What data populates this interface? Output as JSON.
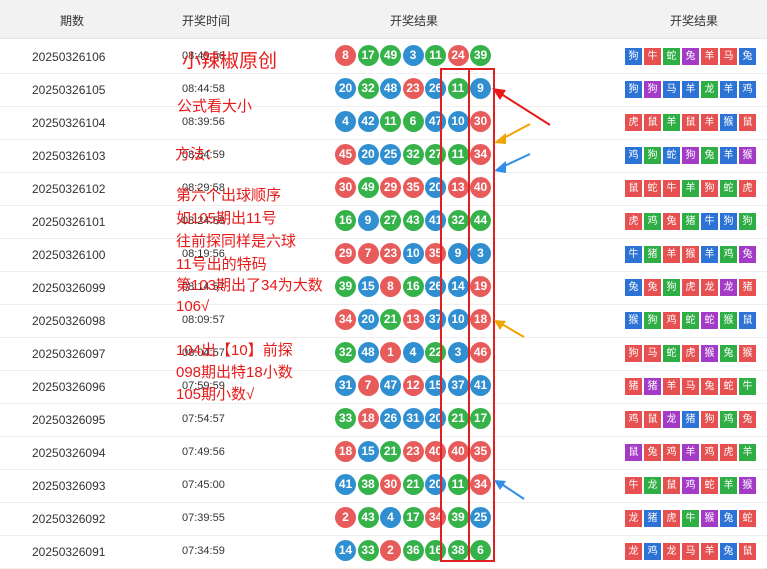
{
  "header": {
    "issue": "期数",
    "time": "开奖时间",
    "balls": "开奖结果",
    "zodiac": "开奖结果"
  },
  "colors": {
    "red": "#e85b5b",
    "blue": "#2f8fd0",
    "green": "#35b34a",
    "purple": "#a33bc6",
    "annot": "#e81919"
  },
  "rows": [
    {
      "issue": "20250326106",
      "time": "08:49:56",
      "balls": [
        [
          "8",
          "red"
        ],
        [
          "17",
          "green"
        ],
        [
          "49",
          "green"
        ],
        [
          "3",
          "blue"
        ],
        [
          "11",
          "green"
        ],
        [
          "24",
          "red"
        ],
        [
          "39",
          "green"
        ]
      ],
      "zodiac": [
        [
          "狗",
          "blue"
        ],
        [
          "牛",
          "red"
        ],
        [
          "蛇",
          "green"
        ],
        [
          "兔",
          "purple"
        ],
        [
          "羊",
          "red"
        ],
        [
          "马",
          "red"
        ],
        [
          "兔",
          "blue"
        ]
      ]
    },
    {
      "issue": "20250326105",
      "time": "08:44:58",
      "balls": [
        [
          "20",
          "blue"
        ],
        [
          "32",
          "green"
        ],
        [
          "48",
          "blue"
        ],
        [
          "23",
          "red"
        ],
        [
          "26",
          "blue"
        ],
        [
          "11",
          "green"
        ],
        [
          "9",
          "blue"
        ]
      ],
      "zodiac": [
        [
          "狗",
          "blue"
        ],
        [
          "狗",
          "purple"
        ],
        [
          "马",
          "blue"
        ],
        [
          "羊",
          "blue"
        ],
        [
          "龙",
          "green"
        ],
        [
          "羊",
          "blue"
        ],
        [
          "鸡",
          "blue"
        ]
      ]
    },
    {
      "issue": "20250326104",
      "time": "08:39:56",
      "balls": [
        [
          "4",
          "blue"
        ],
        [
          "42",
          "blue"
        ],
        [
          "11",
          "green"
        ],
        [
          "6",
          "green"
        ],
        [
          "47",
          "blue"
        ],
        [
          "10",
          "blue"
        ],
        [
          "30",
          "red"
        ]
      ],
      "zodiac": [
        [
          "虎",
          "red"
        ],
        [
          "鼠",
          "red"
        ],
        [
          "羊",
          "green"
        ],
        [
          "鼠",
          "red"
        ],
        [
          "羊",
          "red"
        ],
        [
          "猴",
          "blue"
        ],
        [
          "鼠",
          "red"
        ]
      ]
    },
    {
      "issue": "20250326103",
      "time": "08:34:59",
      "balls": [
        [
          "45",
          "red"
        ],
        [
          "20",
          "blue"
        ],
        [
          "25",
          "blue"
        ],
        [
          "32",
          "green"
        ],
        [
          "27",
          "green"
        ],
        [
          "11",
          "green"
        ],
        [
          "34",
          "red"
        ]
      ],
      "zodiac": [
        [
          "鸡",
          "blue"
        ],
        [
          "狗",
          "green"
        ],
        [
          "蛇",
          "blue"
        ],
        [
          "狗",
          "purple"
        ],
        [
          "兔",
          "green"
        ],
        [
          "羊",
          "blue"
        ],
        [
          "猴",
          "purple"
        ]
      ]
    },
    {
      "issue": "20250326102",
      "time": "08:29:58",
      "balls": [
        [
          "30",
          "red"
        ],
        [
          "49",
          "green"
        ],
        [
          "29",
          "red"
        ],
        [
          "35",
          "red"
        ],
        [
          "20",
          "blue"
        ],
        [
          "13",
          "red"
        ],
        [
          "40",
          "red"
        ]
      ],
      "zodiac": [
        [
          "鼠",
          "red"
        ],
        [
          "蛇",
          "red"
        ],
        [
          "牛",
          "red"
        ],
        [
          "羊",
          "green"
        ],
        [
          "狗",
          "red"
        ],
        [
          "蛇",
          "green"
        ],
        [
          "虎",
          "red"
        ]
      ]
    },
    {
      "issue": "20250326101",
      "time": "08:24:58",
      "balls": [
        [
          "16",
          "green"
        ],
        [
          "9",
          "blue"
        ],
        [
          "27",
          "green"
        ],
        [
          "43",
          "green"
        ],
        [
          "41",
          "blue"
        ],
        [
          "32",
          "green"
        ],
        [
          "44",
          "green"
        ]
      ],
      "zodiac": [
        [
          "虎",
          "red"
        ],
        [
          "鸡",
          "green"
        ],
        [
          "兔",
          "red"
        ],
        [
          "猪",
          "green"
        ],
        [
          "牛",
          "blue"
        ],
        [
          "狗",
          "blue"
        ],
        [
          "狗",
          "green"
        ]
      ]
    },
    {
      "issue": "20250326100",
      "time": "08:19:56",
      "balls": [
        [
          "29",
          "red"
        ],
        [
          "7",
          "red"
        ],
        [
          "23",
          "red"
        ],
        [
          "10",
          "blue"
        ],
        [
          "35",
          "red"
        ],
        [
          "9",
          "blue"
        ],
        [
          "3",
          "blue"
        ]
      ],
      "zodiac": [
        [
          "牛",
          "blue"
        ],
        [
          "猪",
          "green"
        ],
        [
          "羊",
          "red"
        ],
        [
          "猴",
          "red"
        ],
        [
          "羊",
          "blue"
        ],
        [
          "鸡",
          "green"
        ],
        [
          "兔",
          "purple"
        ]
      ]
    },
    {
      "issue": "20250326099",
      "time": "08:14:57",
      "balls": [
        [
          "39",
          "green"
        ],
        [
          "15",
          "blue"
        ],
        [
          "8",
          "red"
        ],
        [
          "16",
          "green"
        ],
        [
          "26",
          "blue"
        ],
        [
          "14",
          "blue"
        ],
        [
          "19",
          "red"
        ]
      ],
      "zodiac": [
        [
          "兔",
          "blue"
        ],
        [
          "兔",
          "red"
        ],
        [
          "狗",
          "green"
        ],
        [
          "虎",
          "red"
        ],
        [
          "龙",
          "red"
        ],
        [
          "龙",
          "purple"
        ],
        [
          "猪",
          "red"
        ]
      ]
    },
    {
      "issue": "20250326098",
      "time": "08:09:57",
      "balls": [
        [
          "34",
          "red"
        ],
        [
          "20",
          "blue"
        ],
        [
          "21",
          "green"
        ],
        [
          "13",
          "red"
        ],
        [
          "37",
          "blue"
        ],
        [
          "10",
          "blue"
        ],
        [
          "18",
          "red"
        ]
      ],
      "zodiac": [
        [
          "猴",
          "blue"
        ],
        [
          "狗",
          "green"
        ],
        [
          "鸡",
          "red"
        ],
        [
          "蛇",
          "green"
        ],
        [
          "蛇",
          "purple"
        ],
        [
          "猴",
          "green"
        ],
        [
          "鼠",
          "blue"
        ]
      ]
    },
    {
      "issue": "20250326097",
      "time": "08:04:57",
      "balls": [
        [
          "32",
          "green"
        ],
        [
          "48",
          "blue"
        ],
        [
          "1",
          "red"
        ],
        [
          "4",
          "blue"
        ],
        [
          "22",
          "green"
        ],
        [
          "3",
          "blue"
        ],
        [
          "46",
          "red"
        ]
      ],
      "zodiac": [
        [
          "狗",
          "red"
        ],
        [
          "马",
          "red"
        ],
        [
          "蛇",
          "green"
        ],
        [
          "虎",
          "red"
        ],
        [
          "猴",
          "purple"
        ],
        [
          "兔",
          "green"
        ],
        [
          "猴",
          "red"
        ]
      ]
    },
    {
      "issue": "20250326096",
      "time": "07:59:59",
      "balls": [
        [
          "31",
          "blue"
        ],
        [
          "7",
          "red"
        ],
        [
          "47",
          "blue"
        ],
        [
          "12",
          "red"
        ],
        [
          "15",
          "blue"
        ],
        [
          "37",
          "blue"
        ],
        [
          "41",
          "blue"
        ]
      ],
      "zodiac": [
        [
          "猪",
          "red"
        ],
        [
          "猪",
          "purple"
        ],
        [
          "羊",
          "red"
        ],
        [
          "马",
          "red"
        ],
        [
          "兔",
          "red"
        ],
        [
          "蛇",
          "red"
        ],
        [
          "牛",
          "green"
        ]
      ]
    },
    {
      "issue": "20250326095",
      "time": "07:54:57",
      "balls": [
        [
          "33",
          "green"
        ],
        [
          "18",
          "red"
        ],
        [
          "26",
          "blue"
        ],
        [
          "31",
          "blue"
        ],
        [
          "20",
          "blue"
        ],
        [
          "21",
          "green"
        ],
        [
          "17",
          "green"
        ]
      ],
      "zodiac": [
        [
          "鸡",
          "red"
        ],
        [
          "鼠",
          "red"
        ],
        [
          "龙",
          "purple"
        ],
        [
          "猪",
          "blue"
        ],
        [
          "狗",
          "red"
        ],
        [
          "鸡",
          "green"
        ],
        [
          "兔",
          "red"
        ]
      ]
    },
    {
      "issue": "20250326094",
      "time": "07:49:56",
      "balls": [
        [
          "18",
          "red"
        ],
        [
          "15",
          "blue"
        ],
        [
          "21",
          "green"
        ],
        [
          "23",
          "red"
        ],
        [
          "40",
          "red"
        ],
        [
          "40",
          "red"
        ],
        [
          "35",
          "red"
        ]
      ],
      "zodiac": [
        [
          "鼠",
          "purple"
        ],
        [
          "兔",
          "red"
        ],
        [
          "鸡",
          "red"
        ],
        [
          "羊",
          "purple"
        ],
        [
          "鸡",
          "red"
        ],
        [
          "虎",
          "red"
        ],
        [
          "羊",
          "green"
        ]
      ]
    },
    {
      "issue": "20250326093",
      "time": "07:45:00",
      "balls": [
        [
          "41",
          "blue"
        ],
        [
          "38",
          "green"
        ],
        [
          "30",
          "red"
        ],
        [
          "21",
          "green"
        ],
        [
          "20",
          "blue"
        ],
        [
          "11",
          "green"
        ],
        [
          "34",
          "red"
        ]
      ],
      "zodiac": [
        [
          "牛",
          "red"
        ],
        [
          "龙",
          "green"
        ],
        [
          "鼠",
          "red"
        ],
        [
          "鸡",
          "purple"
        ],
        [
          "蛇",
          "red"
        ],
        [
          "羊",
          "green"
        ],
        [
          "猴",
          "purple"
        ]
      ]
    },
    {
      "issue": "20250326092",
      "time": "07:39:55",
      "balls": [
        [
          "2",
          "red"
        ],
        [
          "43",
          "green"
        ],
        [
          "4",
          "blue"
        ],
        [
          "17",
          "green"
        ],
        [
          "34",
          "red"
        ],
        [
          "39",
          "green"
        ],
        [
          "25",
          "blue"
        ]
      ],
      "zodiac": [
        [
          "龙",
          "red"
        ],
        [
          "猪",
          "blue"
        ],
        [
          "虎",
          "red"
        ],
        [
          "牛",
          "green"
        ],
        [
          "猴",
          "purple"
        ],
        [
          "兔",
          "blue"
        ],
        [
          "蛇",
          "red"
        ]
      ]
    },
    {
      "issue": "20250326091",
      "time": "07:34:59",
      "balls": [
        [
          "14",
          "blue"
        ],
        [
          "33",
          "green"
        ],
        [
          "2",
          "red"
        ],
        [
          "36",
          "green"
        ],
        [
          "16",
          "green"
        ],
        [
          "38",
          "green"
        ],
        [
          "6",
          "green"
        ]
      ],
      "zodiac": [
        [
          "龙",
          "red"
        ],
        [
          "鸡",
          "blue"
        ],
        [
          "龙",
          "red"
        ],
        [
          "马",
          "red"
        ],
        [
          "羊",
          "red"
        ],
        [
          "兔",
          "blue"
        ],
        [
          "鼠",
          "red"
        ]
      ]
    }
  ],
  "annotations": {
    "title": "小辣椒原创",
    "line1": "公式看大小",
    "line2": "方法：",
    "line3": "第六个出球顺序",
    "line4": "如105期出11号",
    "line5": "往前探同样是六球",
    "line6": "11号出的特码",
    "line7": "第103期出了34为大数",
    "line8": "106√",
    "line9": "104出【10】前探",
    "line10": "098期出特18小数",
    "line11": "105期小数√"
  }
}
